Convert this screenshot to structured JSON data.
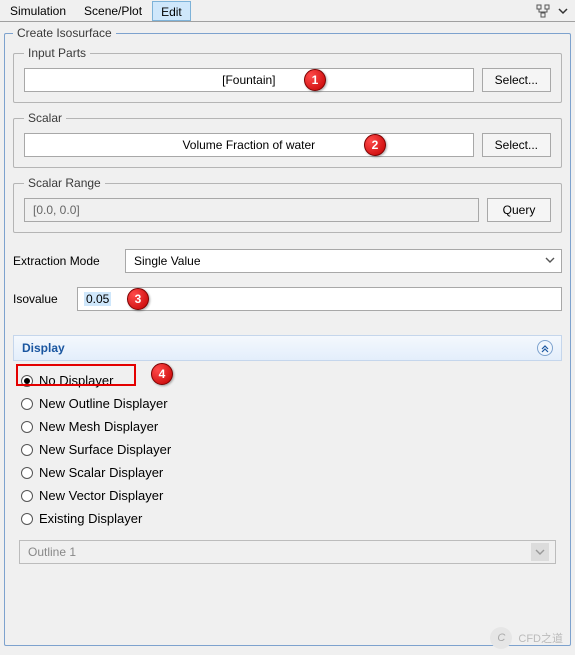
{
  "topbar": {
    "tab_simulation": "Simulation",
    "tab_sceneplot": "Scene/Plot",
    "tab_edit": "Edit"
  },
  "panel": {
    "title": "Create Isosurface",
    "input_parts": {
      "legend": "Input Parts",
      "value": "[Fountain]",
      "select_btn": "Select..."
    },
    "scalar": {
      "legend": "Scalar",
      "value": "Volume Fraction of water",
      "select_btn": "Select..."
    },
    "scalar_range": {
      "legend": "Scalar Range",
      "value": "[0.0, 0.0]",
      "query_btn": "Query"
    },
    "extraction_mode": {
      "label": "Extraction Mode",
      "value": "Single Value"
    },
    "isovalue": {
      "label": "Isovalue",
      "value": "0.05"
    },
    "display": {
      "header": "Display",
      "options": [
        "No Displayer",
        "New Outline Displayer",
        "New Mesh Displayer",
        "New Surface Displayer",
        "New Scalar Displayer",
        "New Vector Displayer",
        "Existing Displayer"
      ],
      "selected_index": 0,
      "existing_value": "Outline 1"
    }
  },
  "callouts": [
    "1",
    "2",
    "3",
    "4"
  ],
  "watermark": "CFD之道"
}
